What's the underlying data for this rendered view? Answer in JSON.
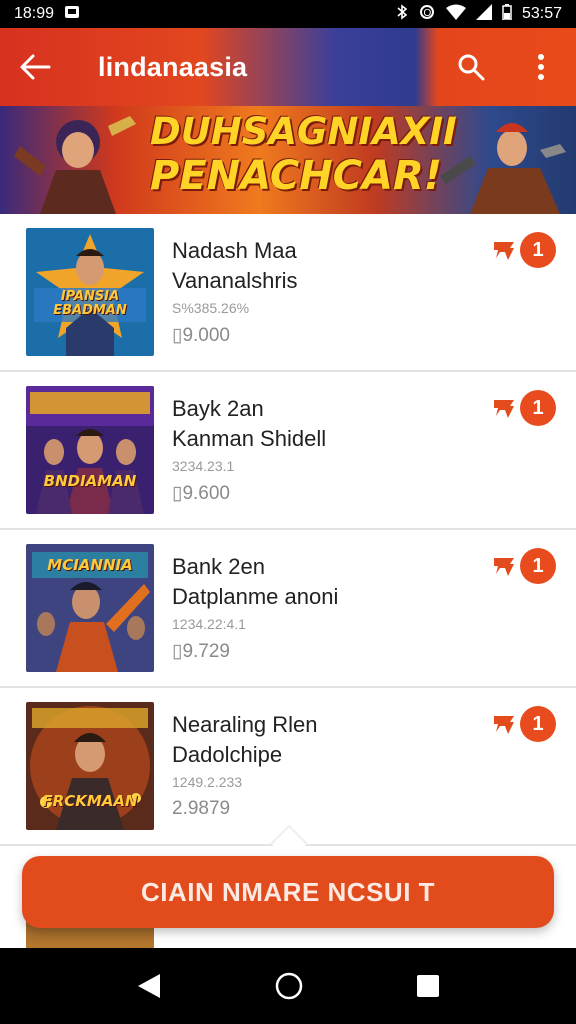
{
  "status_bar": {
    "time_left": "18:99",
    "time_right": "53:57"
  },
  "app_bar": {
    "title": "lindanaasia"
  },
  "banner": {
    "line1": "DUHSAGNIAXII",
    "line2": "PENACHCAR!"
  },
  "items": [
    {
      "thumb_caption": "IPANSIA EBADMAN",
      "line1": "Nadash Maa",
      "line2": "Vananalshris",
      "meta": "S%385.26%",
      "price": "▯9.000",
      "badge": "1"
    },
    {
      "thumb_caption": "BNDIAMAN",
      "line1": "Bayk 2an",
      "line2": "Kanman Shidell",
      "meta": "3234.23.1",
      "price": "▯9.600",
      "badge": "1"
    },
    {
      "thumb_caption": "MCIANNIA",
      "line1": "Bank 2en",
      "line2": "Datplanme anoni",
      "meta": "1234.22:4.1",
      "price": "▯9.729",
      "badge": "1"
    },
    {
      "thumb_caption": "FRCKMAAN",
      "line1": "Nearaling Rlen",
      "line2": "Dadolchipe",
      "meta": "1249.2.233",
      "price": "2.9879",
      "badge": "1"
    }
  ],
  "cta": {
    "label": "CIAIN NMARE NCSUI T"
  },
  "colors": {
    "accent": "#e24c1c",
    "badge": "#e84b1e",
    "status_bar": "#000000"
  }
}
